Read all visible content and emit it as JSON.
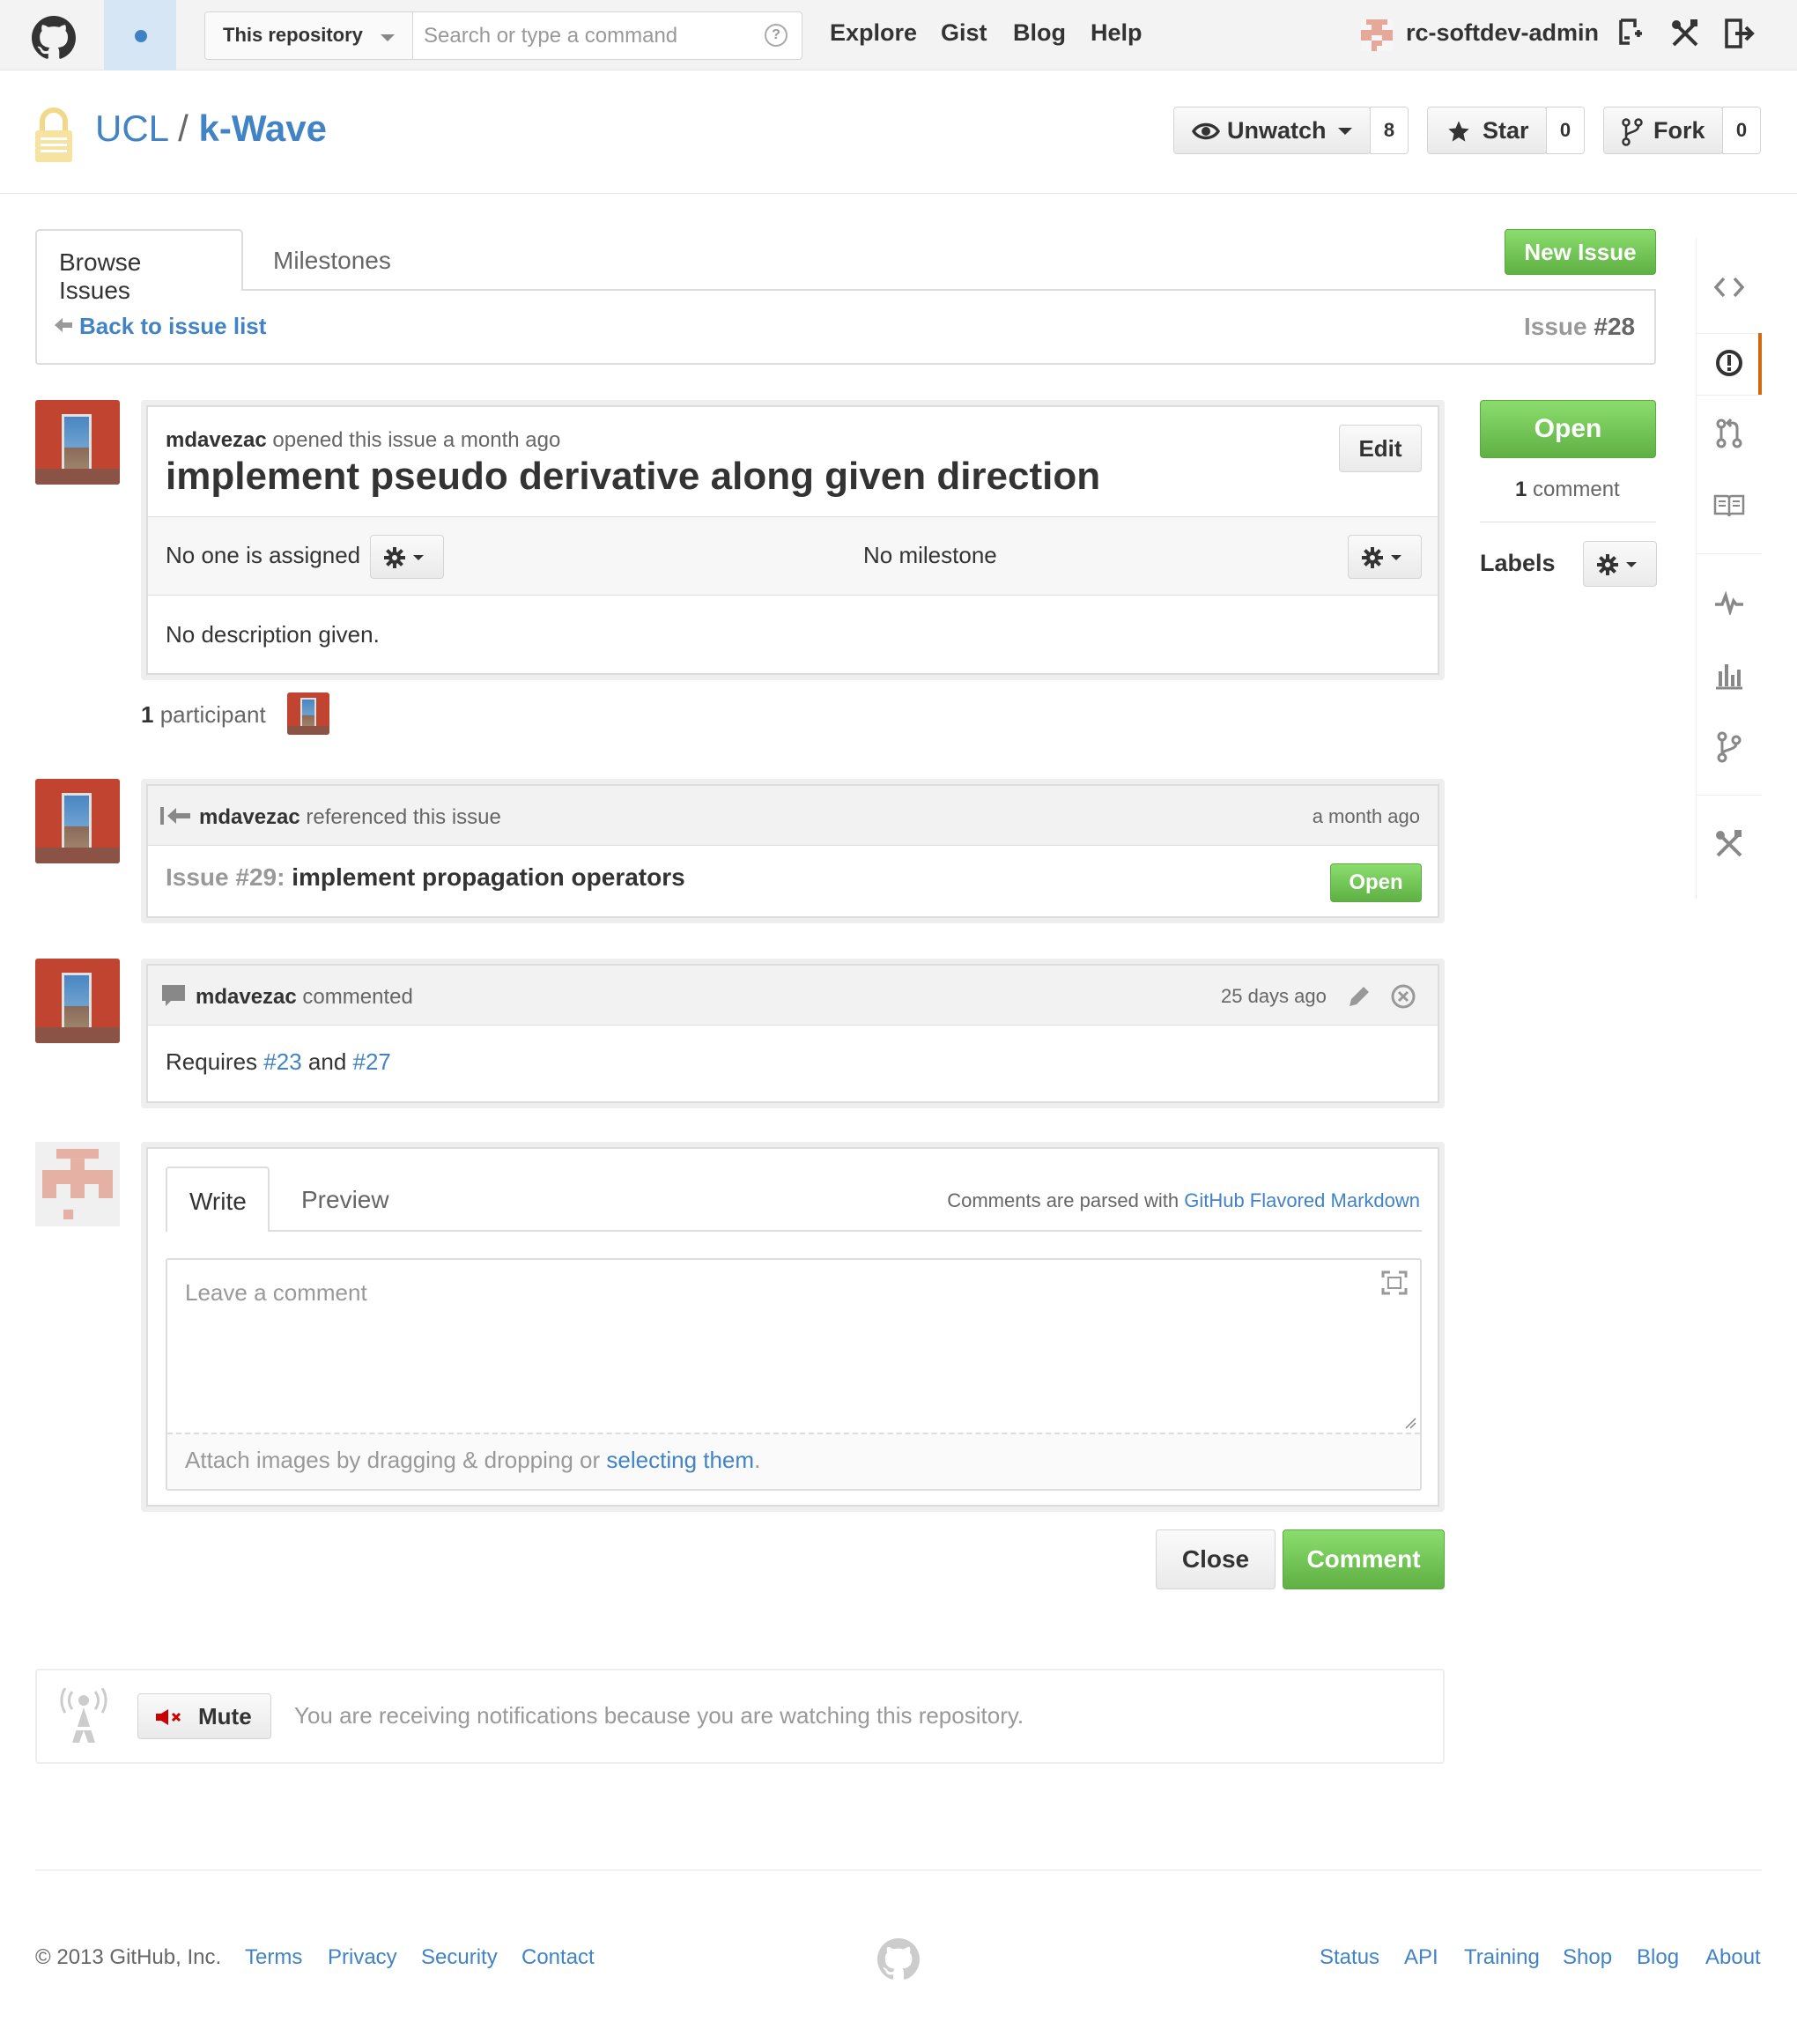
{
  "header": {
    "scope_label": "This repository",
    "search_placeholder": "Search or type a command",
    "search_help": "?",
    "nav": [
      "Explore",
      "Gist",
      "Blog",
      "Help"
    ],
    "username": "rc-softdev-admin"
  },
  "repo": {
    "owner": "UCL",
    "separator": "/",
    "name": "k-Wave",
    "unwatch_label": "Unwatch",
    "watch_count": "8",
    "star_label": "Star",
    "star_count": "0",
    "fork_label": "Fork",
    "fork_count": "0"
  },
  "issues_nav": {
    "tabs": [
      "Browse Issues",
      "Milestones"
    ],
    "new_issue_label": "New Issue",
    "back_link": "Back to issue list",
    "issue_number_prefix": "Issue ",
    "issue_number": "#28"
  },
  "issue": {
    "author": "mdavezac",
    "opened_text": "opened this issue a month ago",
    "edit_label": "Edit",
    "title": "implement pseudo derivative along given direction",
    "assignee_text": "No one is assigned",
    "milestone_text": "No milestone",
    "description": "No description given.",
    "participants_count": "1",
    "participants_label": "participant"
  },
  "status_sidebar": {
    "state_label": "Open",
    "comment_count": "1",
    "comment_label": "comment",
    "labels_heading": "Labels"
  },
  "timeline": {
    "reference": {
      "author": "mdavezac",
      "action": "referenced this issue",
      "time": "a month ago",
      "issue_prefix": "Issue #29:",
      "issue_title": "implement propagation operators",
      "issue_state": "Open"
    },
    "comment": {
      "author": "mdavezac",
      "action": "commented",
      "time": "25 days ago",
      "body_prefix": "Requires ",
      "ref1": "#23",
      "body_mid": " and ",
      "ref2": "#27"
    }
  },
  "composer": {
    "tabs": [
      "Write",
      "Preview"
    ],
    "markdown_note_prefix": "Comments are parsed with ",
    "markdown_link": "GitHub Flavored Markdown",
    "placeholder": "Leave a comment",
    "attach_prefix": "Attach images by dragging & dropping or ",
    "attach_link": "selecting them",
    "attach_suffix": ".",
    "close_label": "Close",
    "comment_label": "Comment"
  },
  "notifications": {
    "mute_label": "Mute",
    "message": "You are receiving notifications because you are watching this repository."
  },
  "footer": {
    "copyright": "© 2013 GitHub, Inc.",
    "left_links": [
      "Terms",
      "Privacy",
      "Security",
      "Contact"
    ],
    "right_links": [
      "Status",
      "API",
      "Training",
      "Shop",
      "Blog",
      "About"
    ]
  },
  "colors": {
    "link": "#4183c4",
    "green": "#6cc644",
    "active_nav_marker": "#d26911"
  }
}
